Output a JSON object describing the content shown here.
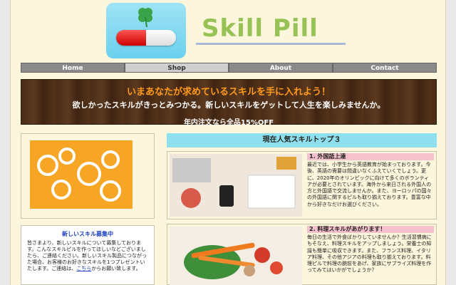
{
  "header": {
    "title": "Skill Pill"
  },
  "nav": {
    "items": [
      "Home",
      "Shop",
      "About",
      "Contact"
    ],
    "active": "Shop"
  },
  "banner": {
    "headline": "いまあなたが求めているスキルを手に入れよう！",
    "subline": "欲しかったスキルがきっとみつかる。新しいスキルをゲットして人生を楽しみませんか。",
    "offer": "年内注文なら全品15%OFF"
  },
  "sidebar": {
    "image_caption": "",
    "news_title": "新しいスキル募集中",
    "news_body": "皆さまより、新しいスキルについて募集しております。こんなスキルピルを作ってほしいなどございましたら、ご連絡ください。新しいスキル製品につながった場合、お客様のお好きなスキルを1つプレゼントいたします。ご連絡は、",
    "news_link": "こちら",
    "news_tail": "からお願い致します。"
  },
  "main": {
    "section_title": "現在人気スキルトップ３",
    "cards": [
      {
        "title": "1. 外国語上達",
        "body": "最近では、小学生から英語教育が始まっております。今後、英語の需要は間違いなくふえていくでしょう。更に、2020年のオリンピックに向けて多くのボランティアが必要とされています。海外から来日される外国人の方と外国語で交流しませんか。また、ヨーロッパの国々の外国語に関するピルも取り揃えております。豊富な中から好きなだけお選びください。"
      },
      {
        "title": "2. 料理スキルがあがります！",
        "body": "毎日の生活で外食ばかりしていませんか？生活習慣病にもそなえ、料理スキルをアップしましょう。栄養士の知識も簡単に吸収できます。また、フランス料理、イタリア料理、その他アジアの料理も取り揃えております。料理ピルで料理の腕前をあげ、家族にサプライズ料理を作ってみてはいかがでしょうか？"
      }
    ]
  },
  "colors": {
    "title": "#97c255",
    "nav": "#8a8a8a",
    "accent": "#ff9a1a",
    "section": "#8fe0ee",
    "card_title": "#f4c1cc"
  }
}
